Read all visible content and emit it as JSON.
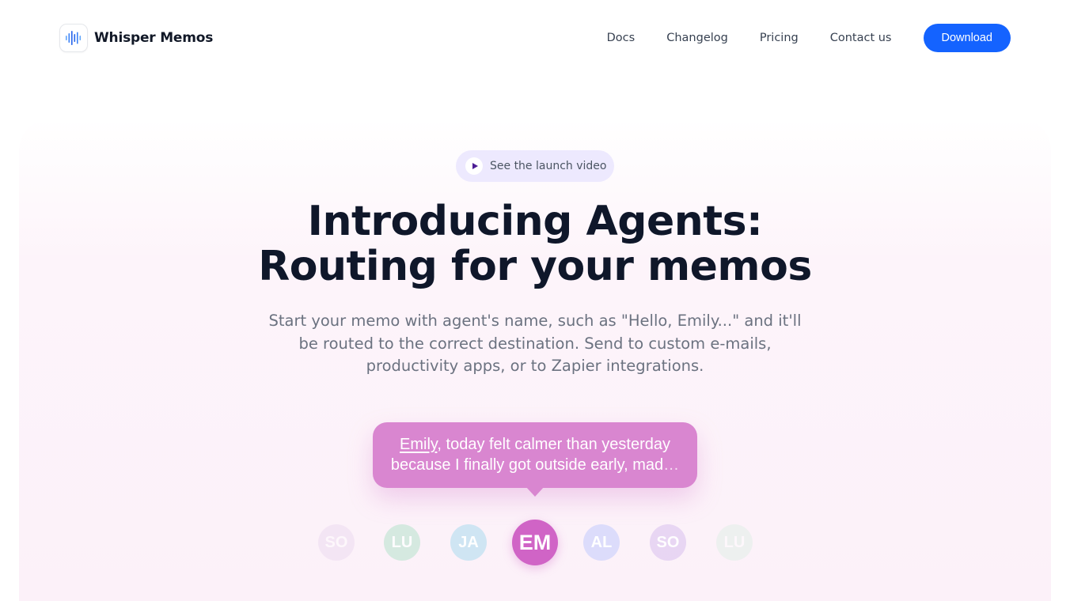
{
  "header": {
    "brand": "Whisper Memos",
    "nav": [
      "Docs",
      "Changelog",
      "Pricing",
      "Contact us"
    ],
    "cta": "Download"
  },
  "hero": {
    "video_link": "See the launch video",
    "title_line1": "Introducing Agents:",
    "title_line2": "Routing for your memos",
    "subtitle": "Start your memo with agent's name, such as \"Hello, Emily...\" and it'll be routed to the correct destination. Send to custom e-mails, productivity apps, or to Zapier integrations.",
    "bubble": {
      "agent_name": "Emily",
      "text": ", today felt calmer than yesterday because I finally got outside early, mad",
      "ellipsis": "…"
    },
    "agents": [
      {
        "initials": "SO",
        "color": "#ead7f0"
      },
      {
        "initials": "LU",
        "color": "#cfe8dc"
      },
      {
        "initials": "JA",
        "color": "#cfe5f3"
      },
      {
        "initials": "EM",
        "color": "#d064c6"
      },
      {
        "initials": "AL",
        "color": "#dcdcfb"
      },
      {
        "initials": "SO",
        "color": "#e6d3f3"
      },
      {
        "initials": "LU",
        "color": "#dcefe4"
      }
    ]
  }
}
